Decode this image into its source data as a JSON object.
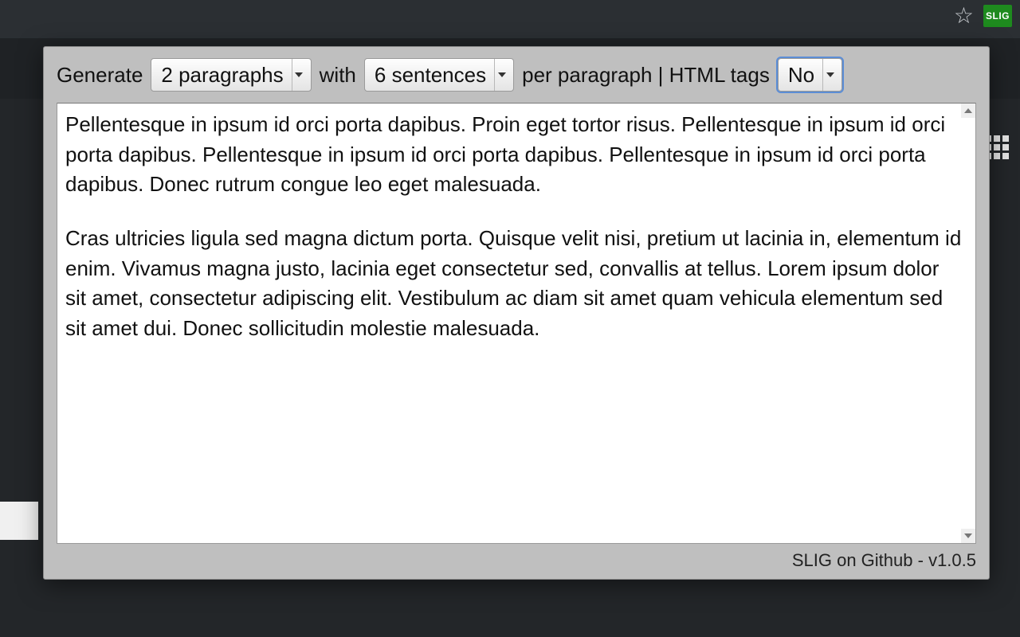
{
  "chrome": {
    "extension_badge": "SLIG"
  },
  "controls": {
    "generate_label": "Generate",
    "paragraphs_selected": "2 paragraphs",
    "with_label": "with",
    "sentences_selected": "6 sentences",
    "suffix_label": "per paragraph | HTML tags",
    "html_tags_selected": "No"
  },
  "output": {
    "paragraphs": [
      "Pellentesque in ipsum id orci porta dapibus. Proin eget tortor risus. Pellentesque in ipsum id orci porta dapibus. Pellentesque in ipsum id orci porta dapibus. Pellentesque in ipsum id orci porta dapibus. Donec rutrum congue leo eget malesuada.",
      "Cras ultricies ligula sed magna dictum porta. Quisque velit nisi, pretium ut lacinia in, elementum id enim. Vivamus magna justo, lacinia eget consectetur sed, convallis at tellus. Lorem ipsum dolor sit amet, consectetur adipiscing elit. Vestibulum ac diam sit amet quam vehicula elementum sed sit amet dui. Donec sollicitudin molestie malesuada."
    ]
  },
  "footer": {
    "link_text": "SLIG on Github",
    "version": "v1.0.5",
    "separator": " - "
  }
}
